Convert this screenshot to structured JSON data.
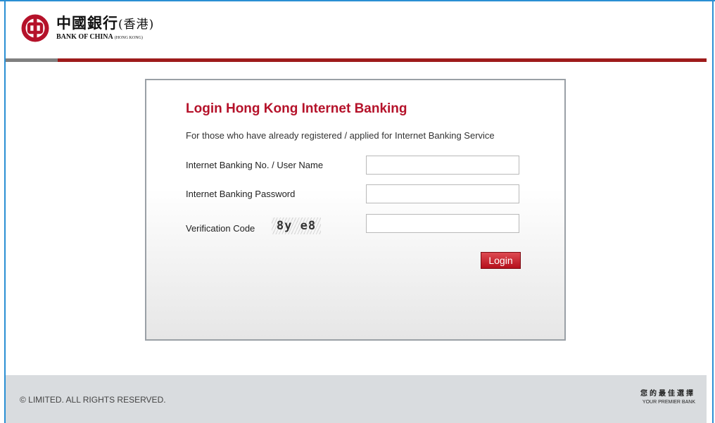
{
  "header": {
    "logo_cn": "中國銀行",
    "logo_cn_sub": "(香港)",
    "logo_en": "BANK OF CHINA",
    "logo_en_sub": "(HONG KONG)"
  },
  "colors": {
    "brand_red": "#b5122a",
    "accent_red_rule": "#9e1b1b",
    "frame_blue": "#2a8fd3",
    "footer_bg": "#d9dcdf"
  },
  "login": {
    "title": "Login Hong Kong Internet Banking",
    "subtitle": "For those who have already registered / applied for Internet Banking Service",
    "username_label": "Internet Banking No. / User Name",
    "username_value": "",
    "password_label": "Internet Banking Password",
    "password_value": "",
    "verification_label": "Verification Code",
    "captcha_text": "8y e8",
    "verification_value": "",
    "login_button": "Login"
  },
  "footer": {
    "copyright": "© LIMITED. ALL RIGHTS RESERVED.",
    "slogan_cn": "您的最佳選擇",
    "slogan_en": "YOUR PREMIER BANK"
  }
}
